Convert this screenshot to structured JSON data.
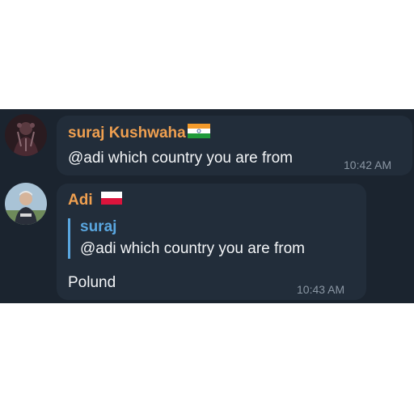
{
  "messages": [
    {
      "sender": "suraj Kushwaha",
      "sender_color": "#f0a050",
      "flag_icon": "india-flag-icon",
      "avatar_icon": "user-avatar-icon",
      "text": "@adi which country you are from",
      "time": "10:42 AM"
    },
    {
      "sender": "Adi",
      "sender_color": "#f0a050",
      "flag_icon": "poland-flag-icon",
      "avatar_icon": "user-avatar-icon",
      "reply": {
        "name": "suraj",
        "text": "@adi which country you are from"
      },
      "text": "Polund",
      "time": "10:43 AM"
    }
  ],
  "colors": {
    "chat_background": "#1b242f",
    "bubble_background": "#222d3a",
    "reply_accent": "#5aa7e0",
    "timestamp": "#8a96a3"
  }
}
